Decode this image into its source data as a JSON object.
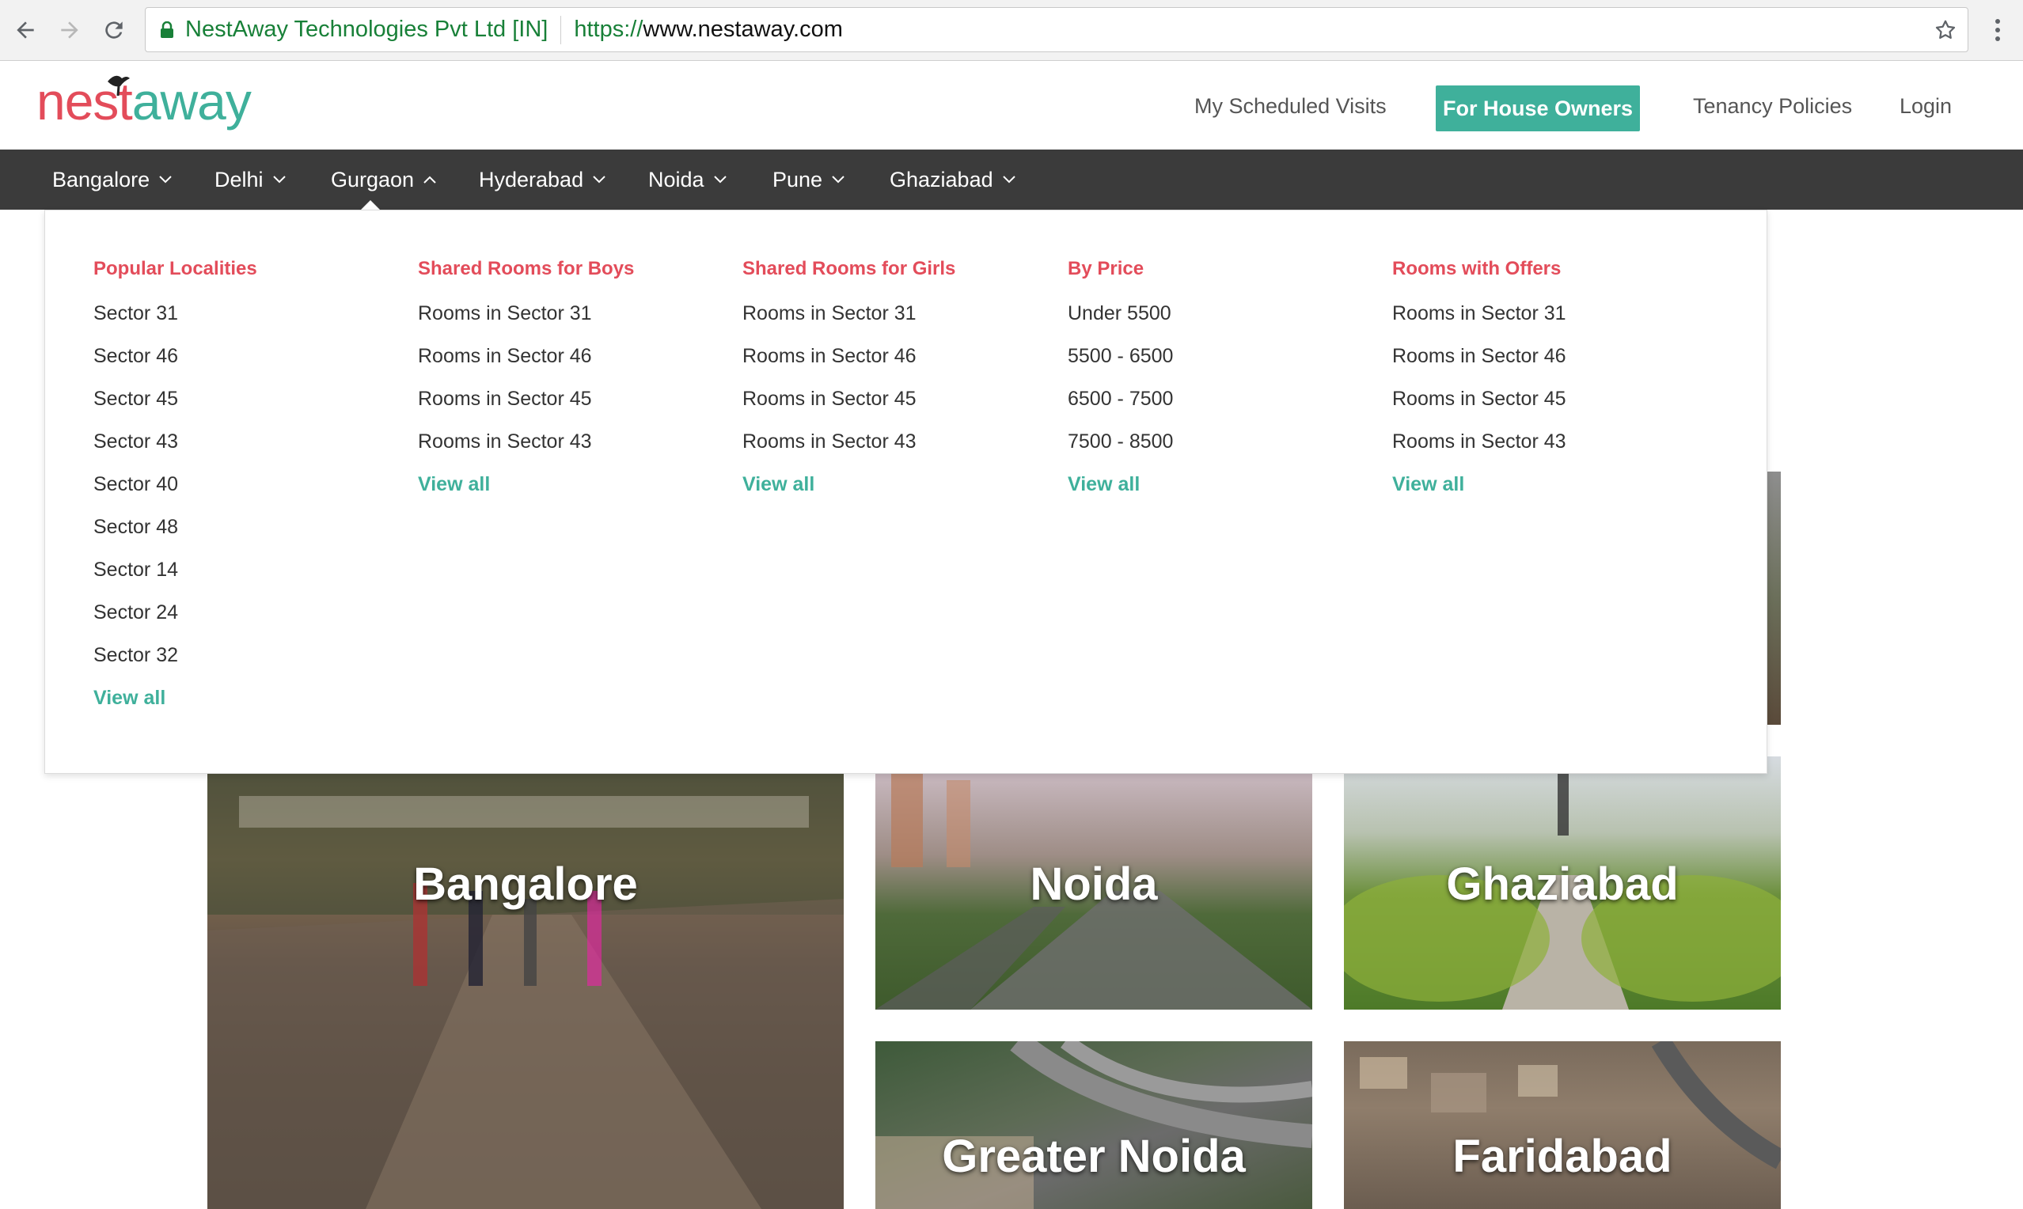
{
  "browser": {
    "secure_label": "NestAway Technologies Pvt Ltd [IN]",
    "url_scheme": "https://",
    "url_host": "www.nestaway.com"
  },
  "header": {
    "logo_nest": "nest",
    "logo_away": "away",
    "links": [
      "My Scheduled Visits",
      "For House Owners",
      "Tenancy Policies",
      "Login"
    ]
  },
  "cities_nav": [
    "Bangalore",
    "Delhi",
    "Gurgaon",
    "Hyderabad",
    "Noida",
    "Pune",
    "Ghaziabad"
  ],
  "active_city": "Gurgaon",
  "dropdown": {
    "columns": [
      {
        "heading": "Popular Localities",
        "items": [
          "Sector 31",
          "Sector 46",
          "Sector 45",
          "Sector 43",
          "Sector 40",
          "Sector 48",
          "Sector 14",
          "Sector 24",
          "Sector 32"
        ],
        "view_all": "View all"
      },
      {
        "heading": "Shared Rooms for Boys",
        "items": [
          "Rooms in Sector 31",
          "Rooms in Sector 46",
          "Rooms in Sector 45",
          "Rooms in Sector 43"
        ],
        "view_all": "View all"
      },
      {
        "heading": "Shared Rooms for Girls",
        "items": [
          "Rooms in Sector 31",
          "Rooms in Sector 46",
          "Rooms in Sector 45",
          "Rooms in Sector 43"
        ],
        "view_all": "View all"
      },
      {
        "heading": "By Price",
        "items": [
          "Under 5500",
          "5500 - 6500",
          "6500 - 7500",
          "7500 - 8500"
        ],
        "view_all": "View all"
      },
      {
        "heading": "Rooms with Offers",
        "items": [
          "Rooms in Sector 31",
          "Rooms in Sector 46",
          "Rooms in Sector 45",
          "Rooms in Sector 43"
        ],
        "view_all": "View all"
      }
    ]
  },
  "tiles": [
    "Bangalore",
    "Noida",
    "Ghaziabad",
    "Greater Noida",
    "Faridabad"
  ],
  "colors": {
    "brand_red": "#e34c5a",
    "brand_teal": "#3fb09b",
    "nav_bg": "#3b3b3b"
  }
}
